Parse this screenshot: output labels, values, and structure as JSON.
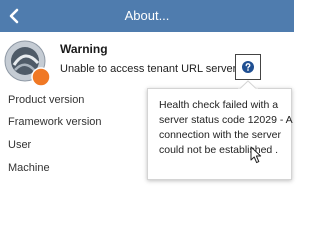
{
  "window": {
    "title": "About..."
  },
  "icons": {
    "back": "chevron-left-icon",
    "logo": "app-logo-icon",
    "help": "question-mark-icon",
    "cursor": "mouse-cursor-icon"
  },
  "colors": {
    "titlebar": "#4f7cae",
    "badge": "#f07824",
    "help_icon": "#1f4f92"
  },
  "warning": {
    "heading": "Warning",
    "message": "Unable to access tenant URL server."
  },
  "info": {
    "labels": [
      "Product version",
      "Framework version",
      "User",
      "Machine"
    ]
  },
  "tooltip": {
    "text": "Health check failed with a server status code 12029 - A connection with the server could not be established ."
  }
}
